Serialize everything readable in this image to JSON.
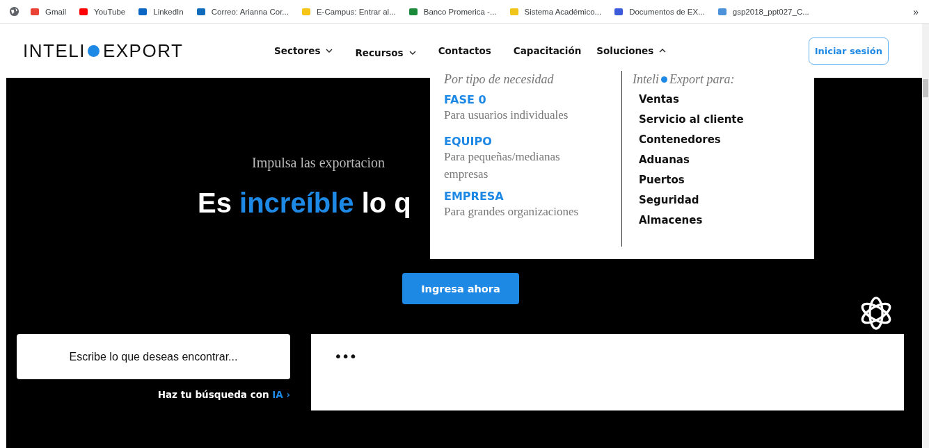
{
  "bookmarks_bar": {
    "items": [
      {
        "label": "Gmail"
      },
      {
        "label": "YouTube"
      },
      {
        "label": "LinkedIn"
      },
      {
        "label": "Correo: Arianna Cor..."
      },
      {
        "label": "E-Campus: Entrar al..."
      },
      {
        "label": "Banco Promerica -..."
      },
      {
        "label": "Sistema Académico..."
      },
      {
        "label": "Documentos de EX..."
      },
      {
        "label": "gsp2018_ppt027_C..."
      }
    ],
    "overflow": "»"
  },
  "header": {
    "logo": {
      "left": "INTELI",
      "right": "EXPORT"
    },
    "nav": [
      {
        "label": "Sectores",
        "kind": "dropdown",
        "expanded": false
      },
      {
        "label": "Recursos",
        "kind": "dropdown",
        "expanded": false
      },
      {
        "label": "Contactos",
        "kind": "link"
      },
      {
        "label": "Capacitación",
        "kind": "link"
      },
      {
        "label": "Soluciones",
        "kind": "dropdown",
        "expanded": true
      }
    ],
    "login_button": "Iniciar sesión"
  },
  "solutions_menu": {
    "left_heading": "Por tipo de necesidad",
    "plans": [
      {
        "name": "FASE 0",
        "description": "Para usuarios individuales"
      },
      {
        "name": "EQUIPO",
        "description": "Para pequeñas/medianas empresas"
      },
      {
        "name": "EMPRESA",
        "description": "Para grandes organizaciones"
      }
    ],
    "right_heading": {
      "before": "Inteli",
      "after": "Export para:"
    },
    "areas": [
      "Ventas",
      "Servicio al cliente",
      "Contenedores",
      "Aduanas",
      "Puertos",
      "Seguridad",
      "Almacenes"
    ]
  },
  "hero": {
    "subtitle": "Impulsa las exportacion",
    "headline_lines": [
      [
        {
          "text": "Es",
          "highlight": false
        },
        {
          "text": "increíble",
          "highlight": true
        },
        {
          "text": "lo q",
          "highlight": false
        }
      ]
    ],
    "cta_button": "Ingresa ahora"
  },
  "search": {
    "placeholder": "Escribe lo que deseas encontrar...",
    "hint": {
      "before": "Haz tu búsqueda con",
      "highlight": "IA",
      "arrow": "›"
    }
  },
  "chat_panel": {
    "typing_indicator": "•••"
  }
}
